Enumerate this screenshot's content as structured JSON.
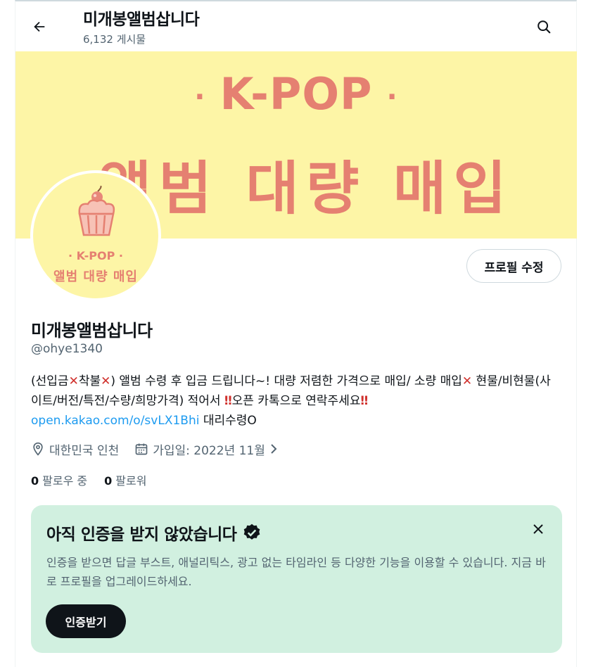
{
  "header": {
    "title": "미개봉앨범삽니다",
    "post_count": "6,132 게시물"
  },
  "banner": {
    "line1_dot_left": "·",
    "line1_text": "K-POP",
    "line1_dot_right": "·",
    "line2_text": "앨범 대량 매입"
  },
  "avatar": {
    "line1": "· K-POP ·",
    "line2": "앨범 대량 매입"
  },
  "profile": {
    "edit_button": "프로필 수정",
    "display_name": "미개봉앨범삽니다",
    "handle": "@ohye1340",
    "bio_1": "(선입금",
    "bio_2": "착불",
    "bio_3": ") 앨범 수령 후 입금 드립니다~! 대량 저렴한 가격으로 매입/ 소량 매입",
    "bio_4": " 현물/비현물(사이트/버전/특전/수량/희망가격) 적어서 ",
    "bio_5": "오픈 카톡으로 연락주세요",
    "bio_link": "open.kakao.com/o/svLX1Bhi",
    "bio_6": " 대리수령O",
    "cross_glyph": "✕",
    "exclaim_glyph": "‼",
    "location": "대한민국 인천",
    "joined": "가입일: 2022년 11월",
    "following_count": "0",
    "following_label": "팔로우 중",
    "followers_count": "0",
    "followers_label": "팔로워"
  },
  "verify": {
    "title": "아직 인증을 받지 않았습니다",
    "description": "인증을 받으면 답글 부스트, 애널리틱스, 광고 없는 타임라인 등 다양한 기능을 이용할 수 있습니다. 지금 바로 프로필을 업그레이드하세요.",
    "button": "인증받기"
  },
  "icons": {
    "back": "arrow-left-icon",
    "search": "search-icon",
    "location": "location-pin-icon",
    "calendar": "calendar-icon",
    "chevron": "chevron-right-icon",
    "verified": "verified-badge-icon",
    "close": "close-icon"
  },
  "colors": {
    "banner_bg": "#fdf5a6",
    "banner_text": "#e58071",
    "link": "#1d9bf0",
    "verify_bg": "#d1f0e0",
    "cross_red": "#d0312d"
  }
}
